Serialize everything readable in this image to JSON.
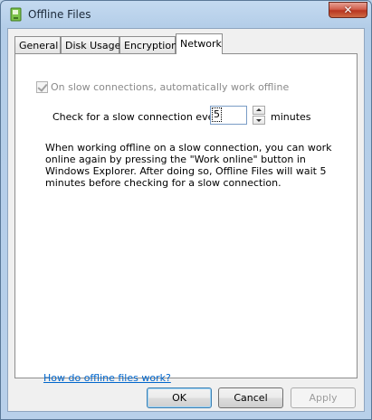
{
  "window": {
    "title": "Offline Files"
  },
  "titlebar": {
    "close_glyph": "✕"
  },
  "tabs": [
    {
      "label": "General"
    },
    {
      "label": "Disk Usage"
    },
    {
      "label": "Encryption"
    },
    {
      "label": "Network"
    }
  ],
  "network": {
    "checkbox_label": "On slow connections, automatically work offline",
    "checkbox_checked": true,
    "slow_check_label": "Check for a slow connection every",
    "interval_value": "5",
    "interval_unit": "minutes",
    "description": "When working offline on a slow connection, you can work online again by pressing the \"Work online\" button in Windows Explorer. After doing so, Offline Files will wait 5 minutes before checking for a slow connection.",
    "help_link": "How do offline files work?"
  },
  "buttons": {
    "ok": "OK",
    "cancel": "Cancel",
    "apply": "Apply"
  }
}
